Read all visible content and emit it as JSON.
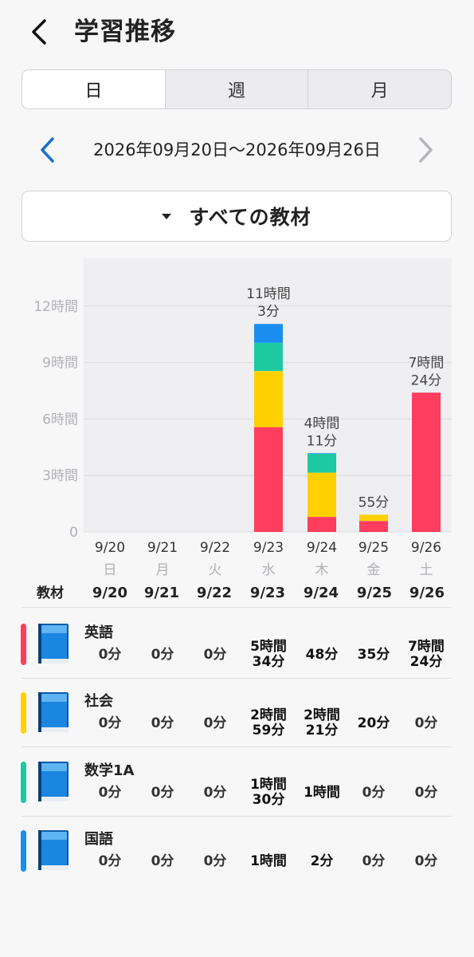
{
  "header": {
    "title": "学習推移",
    "back_icon": "chevron-left-icon"
  },
  "period_tabs": [
    {
      "label": "日",
      "active": true
    },
    {
      "label": "週",
      "active": false
    },
    {
      "label": "月",
      "active": false
    }
  ],
  "date_nav": {
    "range": "2026年09月20日〜2026年09月26日",
    "prev_icon": "chevron-left-icon",
    "next_icon": "chevron-right-icon",
    "prev_color": "#1a6fd0",
    "next_color": "#b6b6bc"
  },
  "material_filter": {
    "label": "すべての教材",
    "icon": "caret-down-icon"
  },
  "colors": {
    "英語": "#ff3d5e",
    "社会": "#ffd000",
    "数学1A": "#1dc9a0",
    "国語": "#1a8ef0"
  },
  "chart_data": {
    "type": "bar",
    "stacked": true,
    "categories": [
      "9/20",
      "9/21",
      "9/22",
      "9/23",
      "9/24",
      "9/25",
      "9/26"
    ],
    "weekdays": [
      "日",
      "月",
      "火",
      "水",
      "木",
      "金",
      "土"
    ],
    "yticks": [
      "0",
      "3時間",
      "6時間",
      "9時間",
      "12時間"
    ],
    "ylim": [
      0,
      13.5
    ],
    "series": [
      {
        "name": "英語",
        "color": "#ff3d5e",
        "values": [
          0,
          0,
          0,
          5.567,
          0.8,
          0.583,
          7.4
        ]
      },
      {
        "name": "社会",
        "color": "#ffd000",
        "values": [
          0,
          0,
          0,
          2.983,
          2.35,
          0.333,
          0
        ]
      },
      {
        "name": "数学1A",
        "color": "#1dc9a0",
        "values": [
          0,
          0,
          0,
          1.5,
          1.0,
          0,
          0
        ]
      },
      {
        "name": "国語",
        "color": "#1a8ef0",
        "values": [
          0,
          0,
          0,
          1.0,
          0.033,
          0,
          0
        ]
      }
    ],
    "totals": [
      "",
      "",
      "",
      "11時間\n3分",
      "4時間\n11分",
      "55分",
      "7時間\n24分"
    ],
    "grid": true
  },
  "table": {
    "header_label": "教材",
    "dates": [
      "9/20",
      "9/21",
      "9/22",
      "9/23",
      "9/24",
      "9/25",
      "9/26"
    ],
    "rows": [
      {
        "name": "英語",
        "color": "#ff3d5e",
        "icon": "book-icon",
        "values": [
          "0分",
          "0分",
          "0分",
          "5時間\n34分",
          "48分",
          "35分",
          "7時間\n24分"
        ]
      },
      {
        "name": "社会",
        "color": "#ffd000",
        "icon": "book-icon",
        "values": [
          "0分",
          "0分",
          "0分",
          "2時間\n59分",
          "2時間\n21分",
          "20分",
          "0分"
        ]
      },
      {
        "name": "数学1A",
        "color": "#1dc9a0",
        "icon": "book-icon",
        "values": [
          "0分",
          "0分",
          "0分",
          "1時間\n30分",
          "1時間",
          "0分",
          "0分"
        ]
      },
      {
        "name": "国語",
        "color": "#1a8ef0",
        "icon": "book-icon",
        "values": [
          "0分",
          "0分",
          "0分",
          "1時間",
          "2分",
          "0分",
          "0分"
        ]
      }
    ]
  }
}
